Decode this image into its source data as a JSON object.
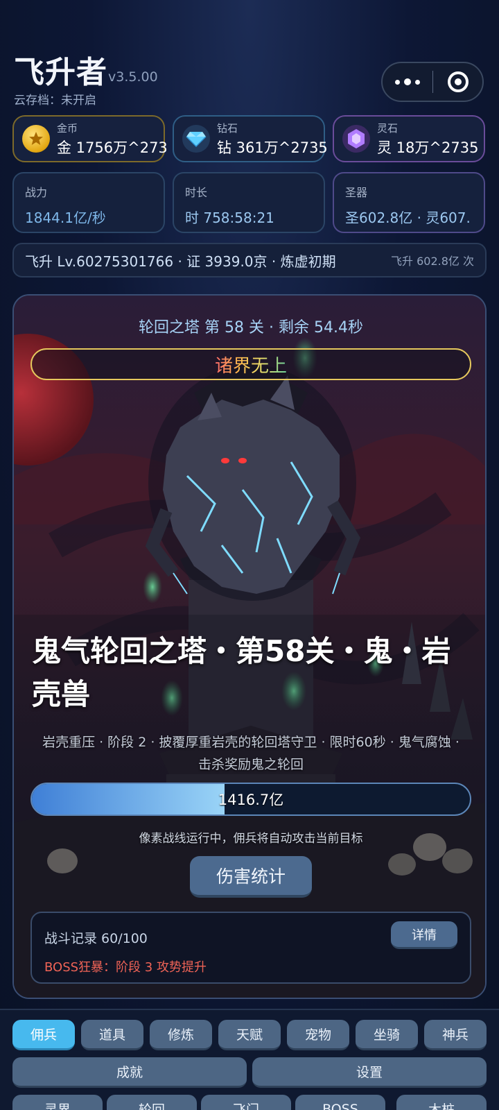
{
  "header": {
    "title": "飞升者",
    "version": "v3.5.00",
    "cloud_save": "云存档：未开启"
  },
  "currencies": {
    "gold": {
      "label": "金币",
      "value": "金 1756万^273",
      "icon": "gold-coin-icon"
    },
    "diamond": {
      "label": "钻石",
      "value": "钻 361万^2735",
      "icon": "diamond-icon"
    },
    "spirit_stone": {
      "label": "灵石",
      "value": "灵 18万^2735",
      "icon": "spirit-stone-icon"
    }
  },
  "stats": {
    "power": {
      "label": "战力",
      "value": "1844.1亿/秒"
    },
    "duration": {
      "label": "时长",
      "value": "时 758:58:21"
    },
    "artifact": {
      "label": "圣器",
      "value": "圣602.8亿 · 灵607."
    }
  },
  "ascension": {
    "main": "飞升 Lv.60275301766 · 证 3939.0京 · 炼虚初期",
    "side": "飞升 602.8亿 次"
  },
  "battle": {
    "stage_title": "轮回之塔 第 58 关 · 剩余 54.4秒",
    "rank": "诸界无上",
    "boss_name": "鬼气轮回之塔・第58关・鬼・岩壳兽",
    "boss_desc": "岩壳重压 · 阶段 2 · 披覆厚重岩壳的轮回塔守卫 · 限时60秒 · 鬼气腐蚀 · 击杀奖励鬼之轮回",
    "hp_text": "1416.7亿",
    "hp_fraction": 0.44,
    "hint": "像素战线运行中，佣兵将自动攻击当前目标",
    "damage_button": "伤害统计",
    "log_count": "战斗记录 60/100",
    "log_warning": "BOSS狂暴：阶段 3 攻势提升",
    "detail_button": "详情"
  },
  "nav": {
    "row1": [
      "佣兵",
      "道具",
      "修炼",
      "天赋",
      "宠物",
      "坐骑",
      "神兵"
    ],
    "row2": [
      "成就",
      "设置"
    ],
    "row3": [
      "灵界",
      "轮回",
      "飞门",
      "BOSS",
      "木桩"
    ],
    "active": "佣兵"
  },
  "colors": {
    "accent": "#47b9ee",
    "warning": "#ef6356",
    "gold_border": "#e6c85d"
  }
}
